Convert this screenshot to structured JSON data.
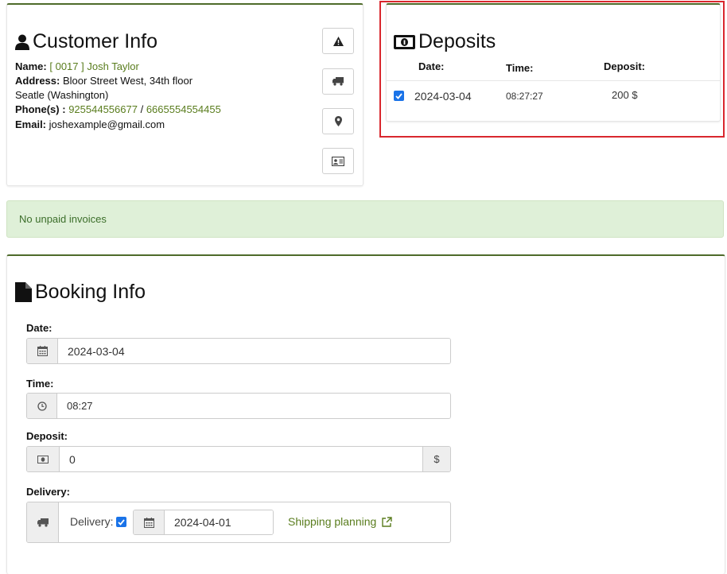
{
  "customer": {
    "title": "Customer Info",
    "name_label": "Name:",
    "name_value": "[ 0017 ] Josh Taylor",
    "address_label": "Address:",
    "address_line1": "Bloor Street West, 34th floor",
    "address_line2": "Seatle (Washington)",
    "phones_label": "Phone(s) :",
    "phone1": "925544556677",
    "phone_separator": "/",
    "phone2": "6665554554455",
    "email_label": "Email:",
    "email_value": "joshexample@gmail.com"
  },
  "deposits": {
    "title": "Deposits",
    "headers": {
      "date": "Date:",
      "time": "Time:",
      "deposit": "Deposit:"
    },
    "rows": [
      {
        "checked": true,
        "date": "2024-03-04",
        "time": "08:27:27",
        "amount": "200",
        "currency": "$"
      }
    ]
  },
  "alert": {
    "text": "No unpaid invoices"
  },
  "booking": {
    "title": "Booking Info",
    "date_label": "Date:",
    "date_value": "2024-03-04",
    "time_label": "Time:",
    "time_value": "08:27",
    "deposit_label": "Deposit:",
    "deposit_value": "0",
    "currency": "$",
    "delivery_label": "Delivery:",
    "delivery_checkbox_label": "Delivery:",
    "delivery_checked": true,
    "delivery_date": "2024-04-01",
    "shipping_link": "Shipping planning"
  },
  "colors": {
    "accent": "#4e6b2a",
    "link": "#5a7d1e",
    "alert_bg": "#dff0d8",
    "highlight": "#d9272e"
  },
  "icons": [
    "user-icon",
    "warning-icon",
    "truck-icon",
    "map-marker-icon",
    "id-card-icon",
    "money-icon",
    "file-icon",
    "calendar-icon",
    "clock-icon",
    "external-link-icon"
  ]
}
